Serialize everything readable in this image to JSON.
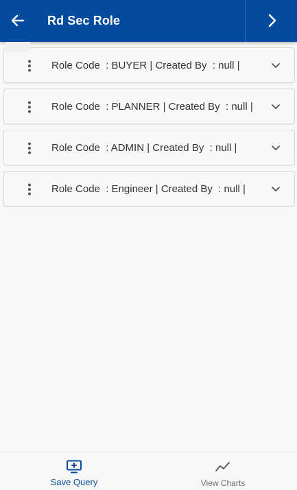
{
  "header": {
    "title": "Rd Sec Role",
    "back_icon": "arrow-left-icon",
    "next_icon": "chevron-right-icon",
    "bg_color": "#034b9c"
  },
  "roles": [
    {
      "text": "Role Code  : BUYER | Created By  : null |"
    },
    {
      "text": "Role Code  : PLANNER | Created By  : null |"
    },
    {
      "text": "Role Code  : ADMIN | Created By  : null |"
    },
    {
      "text": "Role Code  : Engineer | Created By  : null |"
    }
  ],
  "bottom_nav": {
    "save_query": {
      "label": "Save Query",
      "icon": "monitor-plus-icon",
      "color": "#034b9c"
    },
    "view_charts": {
      "label": "View Charts",
      "icon": "line-chart-icon",
      "color": "#6f6f6f"
    }
  }
}
